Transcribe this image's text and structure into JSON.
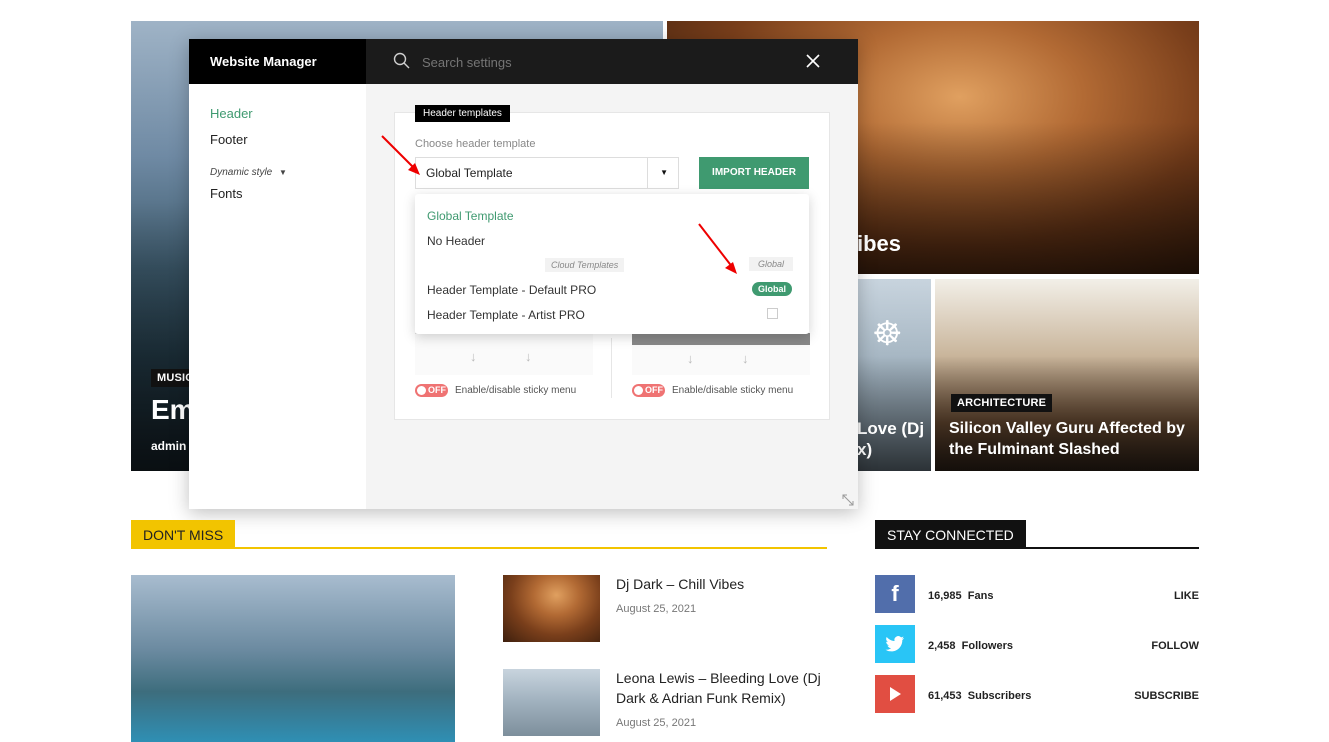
{
  "tiles": {
    "left": {
      "category": "MUSIC",
      "title": "Em",
      "author": "admin"
    },
    "top_right": {
      "title": "ibes"
    },
    "mid": {
      "title": "Love (Dj\nx)"
    },
    "right": {
      "category": "ARCHITECTURE",
      "title": "Silicon Valley Guru Affected by the Fulminant Slashed"
    }
  },
  "modal": {
    "title": "Website Manager",
    "search_placeholder": "Search settings",
    "sidebar": {
      "header": "Header",
      "footer": "Footer",
      "dynamic_style": "Dynamic style",
      "fonts": "Fonts"
    },
    "panel_label": "Header templates",
    "choose_label": "Choose header template",
    "selected_template": "Global Template",
    "import_button": "IMPORT HEADER",
    "dropdown": {
      "items": [
        "Global Template",
        "No Header"
      ],
      "cloud_label": "Cloud Templates",
      "global_label": "Global",
      "cloud_items": [
        "Header Template - Default PRO",
        "Header Template - Artist PRO"
      ],
      "badge": "Global"
    },
    "sticky": {
      "toggle_off": "OFF",
      "label": "Enable/disable sticky menu"
    }
  },
  "dont_miss": {
    "heading": "DON'T MISS",
    "articles": [
      {
        "title": "Dj Dark – Chill Vibes",
        "date": "August 25, 2021"
      },
      {
        "title": "Leona Lewis – Bleeding Love (Dj Dark & Adrian Funk Remix)",
        "date": "August 25, 2021"
      }
    ]
  },
  "stay_connected": {
    "heading": "STAY CONNECTED",
    "items": [
      {
        "icon": "facebook-icon",
        "count": "16,985",
        "label": "Fans",
        "action": "LIKE",
        "color": "#516eab"
      },
      {
        "icon": "twitter-icon",
        "count": "2,458",
        "label": "Followers",
        "action": "FOLLOW",
        "color": "#29c5f6"
      },
      {
        "icon": "youtube-icon",
        "count": "61,453",
        "label": "Subscribers",
        "action": "SUBSCRIBE",
        "color": "#e14e42"
      }
    ]
  },
  "colors": {
    "accent_yellow": "#f2c400",
    "accent_green": "#3f9a70"
  }
}
